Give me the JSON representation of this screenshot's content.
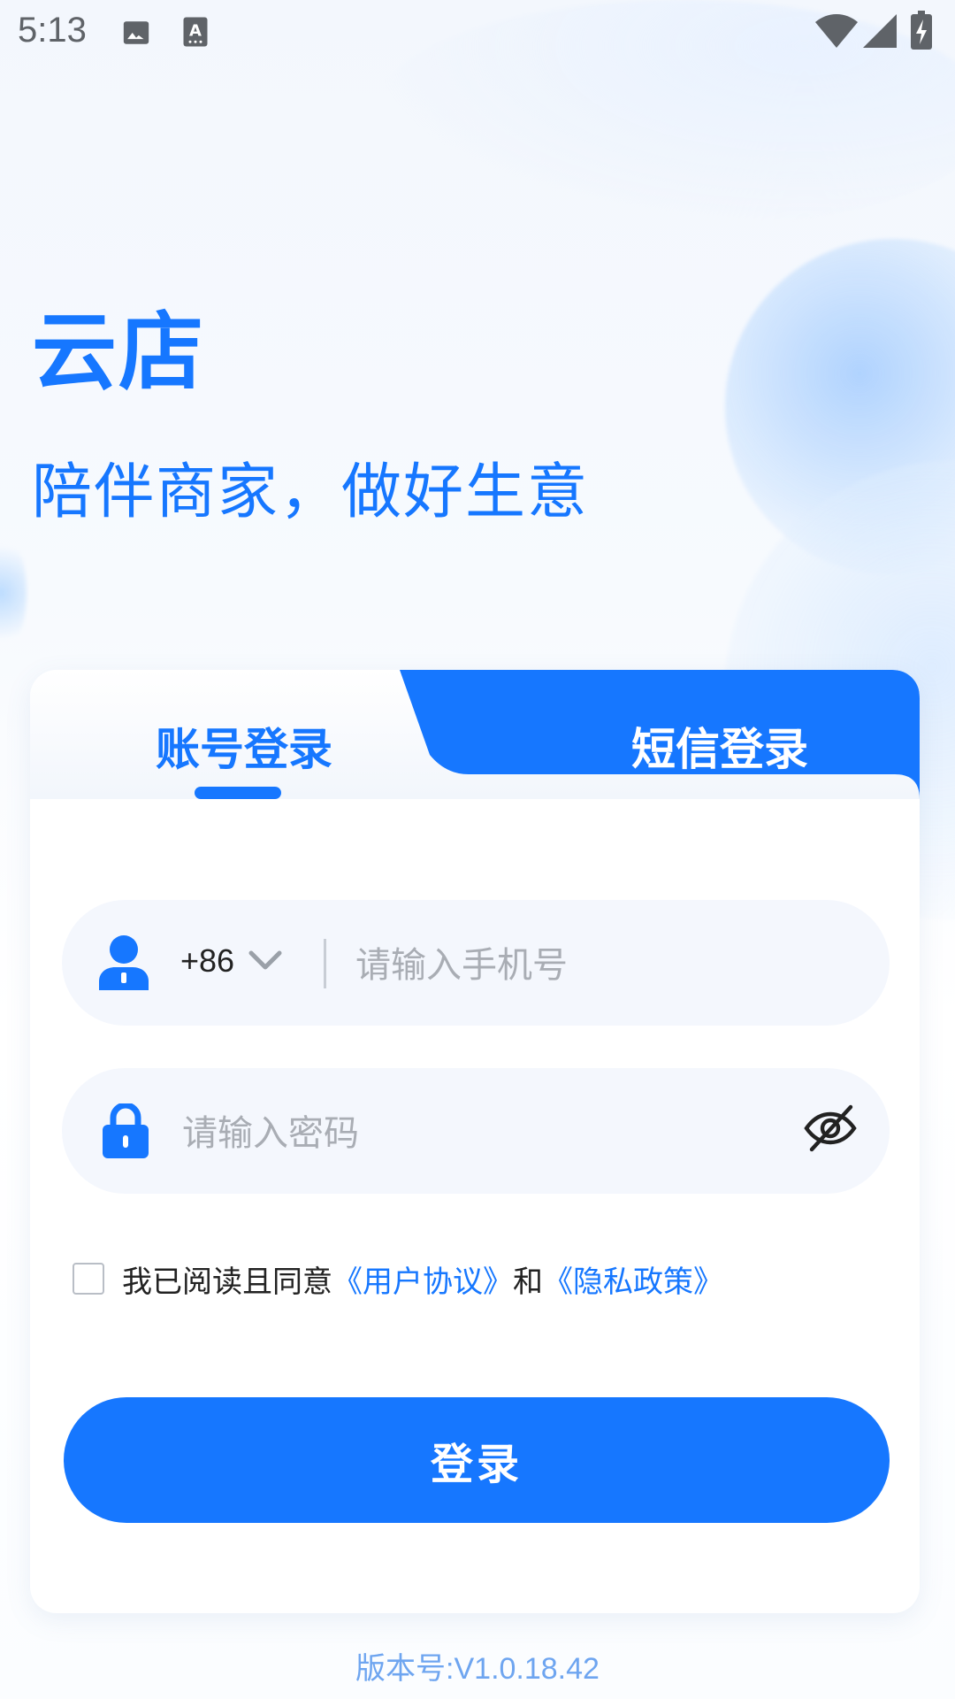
{
  "status_bar": {
    "time": "5:13",
    "icons": [
      "image-icon",
      "text-a-icon",
      "wifi-icon",
      "signal-icon",
      "battery-charging-icon"
    ]
  },
  "hero": {
    "title": "云店",
    "slogan": "陪伴商家，做好生意"
  },
  "tabs": [
    {
      "label": "账号登录",
      "active": true
    },
    {
      "label": "短信登录",
      "active": false
    }
  ],
  "phone_field": {
    "country_code": "+86",
    "placeholder": "请输入手机号",
    "value": ""
  },
  "password_field": {
    "placeholder": "请输入密码",
    "value": ""
  },
  "agreement": {
    "checked": false,
    "prefix": "我已阅读且同意",
    "user_agreement": "《用户协议》",
    "conjunction": "和",
    "privacy_policy": "《隐私政策》"
  },
  "login_button": {
    "label": "登录"
  },
  "version": "版本号:V1.0.18.42",
  "colors": {
    "primary": "#1677ff",
    "field_bg": "#f4f7fd",
    "placeholder": "#a9adb4",
    "version_text": "#6ea5f0"
  }
}
